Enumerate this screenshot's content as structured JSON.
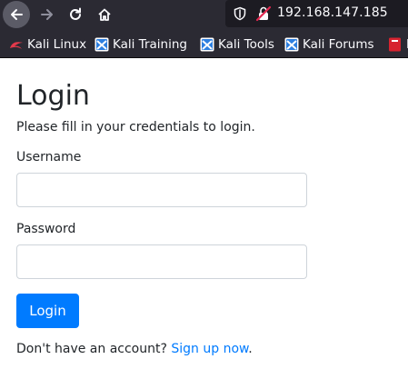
{
  "browser": {
    "url": "192.168.147.185",
    "bookmarks": [
      {
        "label": "Kali Linux",
        "icon": "kali-linux-icon"
      },
      {
        "label": "Kali Training",
        "icon": "kali-training-icon"
      },
      {
        "label": "Kali Tools",
        "icon": "kali-tools-icon"
      },
      {
        "label": "Kali Forums",
        "icon": "kali-forums-icon"
      },
      {
        "label": "K",
        "icon": "kali-docs-icon"
      }
    ],
    "colors": {
      "toolbar_bg": "#2b2a33",
      "urlbar_bg": "#1c1b22",
      "text": "#fbfbfe"
    }
  },
  "page": {
    "title": "Login",
    "subtitle": "Please fill in your credentials to login.",
    "username_label": "Username",
    "username_value": "",
    "password_label": "Password",
    "password_value": "",
    "submit_label": "Login",
    "signup_prompt": "Don't have an account?",
    "signup_link": "Sign up now",
    "signup_period": ".",
    "colors": {
      "primary": "#007bff",
      "text": "#212529",
      "input_border": "#ced4da"
    }
  }
}
